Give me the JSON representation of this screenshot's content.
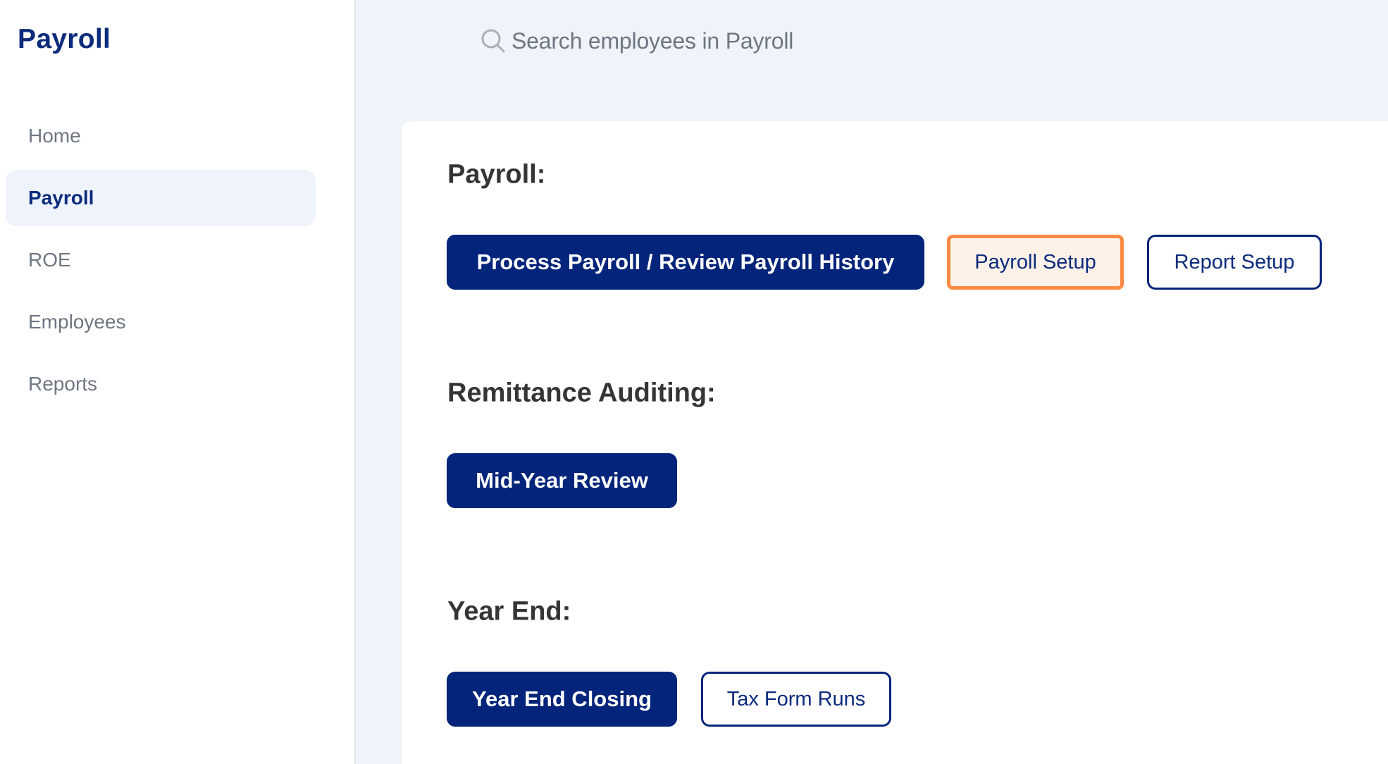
{
  "sidebar": {
    "app_title": "Payroll",
    "items": [
      {
        "label": "Home",
        "active": false
      },
      {
        "label": "Payroll",
        "active": true
      },
      {
        "label": "ROE",
        "active": false
      },
      {
        "label": "Employees",
        "active": false
      },
      {
        "label": "Reports",
        "active": false
      }
    ]
  },
  "search": {
    "icon": "search-icon",
    "placeholder": "Search employees in Payroll"
  },
  "sections": {
    "payroll": {
      "heading": "Payroll:",
      "buttons": {
        "process": "Process Payroll / Review Payroll History",
        "setup": "Payroll Setup",
        "report_setup": "Report Setup"
      }
    },
    "remittance": {
      "heading": "Remittance Auditing:",
      "buttons": {
        "mid_year": "Mid-Year Review"
      }
    },
    "year_end": {
      "heading": "Year End:",
      "buttons": {
        "closing": "Year End Closing",
        "tax_forms": "Tax Form Runs"
      }
    }
  },
  "colors": {
    "brand_navy": "#02247a",
    "highlight_orange": "#fb8a44",
    "highlight_bg": "#fef1e8",
    "page_bg": "#eff3fa"
  }
}
